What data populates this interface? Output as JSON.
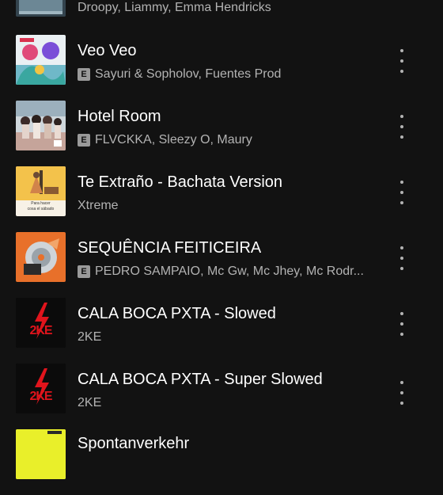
{
  "tracks": [
    {
      "title": "",
      "explicit": false,
      "artists": "Droopy, Liammy, Emma Hendricks",
      "art": "partial-top-icon"
    },
    {
      "title": "Veo Veo",
      "explicit": true,
      "explicit_label": "E",
      "artists": "Sayuri & Sopholov, Fuentes Prod",
      "art": "colorful-cartoon-cover"
    },
    {
      "title": "Hotel Room",
      "explicit": true,
      "explicit_label": "E",
      "artists": "FLVCKKA, Sleezy O, Maury",
      "art": "group-photo-cover"
    },
    {
      "title": "Te Extraño - Bachata Version",
      "explicit": false,
      "artists": "Xtreme",
      "art": "yellow-illustration-cover"
    },
    {
      "title": "SEQUÊNCIA FEITICEIRA",
      "explicit": true,
      "explicit_label": "E",
      "artists": "PEDRO SAMPAIO, Mc Gw, Mc Jhey, Mc Rodr...",
      "art": "orange-cd-cover"
    },
    {
      "title": "CALA BOCA PXTA - Slowed",
      "explicit": false,
      "artists": "2KE",
      "art": "2ke-logo-cover"
    },
    {
      "title": "CALA BOCA PXTA - Super Slowed",
      "explicit": false,
      "artists": "2KE",
      "art": "2ke-logo-cover"
    },
    {
      "title": "Spontanverkehr",
      "explicit": false,
      "artists": "",
      "art": "yellow-cover"
    }
  ],
  "art_caption": {
    "line1": "Para hacer",
    "line2": "cosa el sábado"
  },
  "logo_text": "2KE",
  "colors": {
    "background": "#121212",
    "title": "#ffffff",
    "subtitle": "#b3b3b3"
  }
}
